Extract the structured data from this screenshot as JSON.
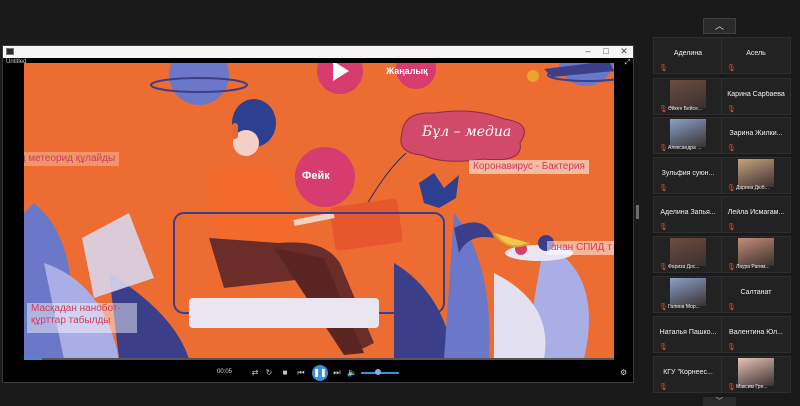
{
  "window": {
    "title": "Untitled",
    "menu_text": ""
  },
  "video": {
    "labels": {
      "news": "Жаңалық",
      "fake": "Фейк",
      "media": "Бұл – медиа",
      "meteor": "ң метеорид құлайды",
      "corona": "Коронавирус - Бактерия",
      "spid": "анан СПИД т",
      "nanobot": "Масқадан нанобот-құрттар табылды"
    },
    "time": "00:05",
    "progress_fraction": 0.03,
    "controls": {
      "shuffle": "⇄",
      "repeat": "↻",
      "stop": "■",
      "prev": "⏮",
      "play_pause": "❚❚",
      "next": "⏭",
      "volume": "🔈",
      "settings": "⚙"
    }
  },
  "gallery": {
    "scroll_up": "︿",
    "scroll_down": "﹀",
    "participants": [
      {
        "name": "Аделина",
        "photo": false
      },
      {
        "name": "Асель",
        "photo": false
      },
      {
        "name": "Әйкен Бейсе...",
        "photo": true
      },
      {
        "name": "Карина Сарбаева",
        "photo": false
      },
      {
        "name": "Александра ...",
        "photo": true
      },
      {
        "name": "Зарина Жилки...",
        "photo": false
      },
      {
        "name": "Зульфия суюн...",
        "photo": false
      },
      {
        "name": "Дарина Дюб...",
        "photo": true
      },
      {
        "name": "Аделина Запья...",
        "photo": false
      },
      {
        "name": "Лейла Исмагам...",
        "photo": false
      },
      {
        "name": "Фариза Дос...",
        "photo": true
      },
      {
        "name": "Лаура Рагим...",
        "photo": true
      },
      {
        "name": "Галина Мор...",
        "photo": true
      },
      {
        "name": "Салтанат",
        "photo": false
      },
      {
        "name": "Наталья Пашко...",
        "photo": false
      },
      {
        "name": "Валентина Юл...",
        "photo": false
      },
      {
        "name": "КГУ \"Корнеес...",
        "photo": false
      },
      {
        "name": "Максим Гре...",
        "photo": true
      }
    ]
  },
  "colors": {
    "video_bg": "#ec6c32",
    "accent": "#3f8fd6",
    "mute": "#e24848"
  }
}
